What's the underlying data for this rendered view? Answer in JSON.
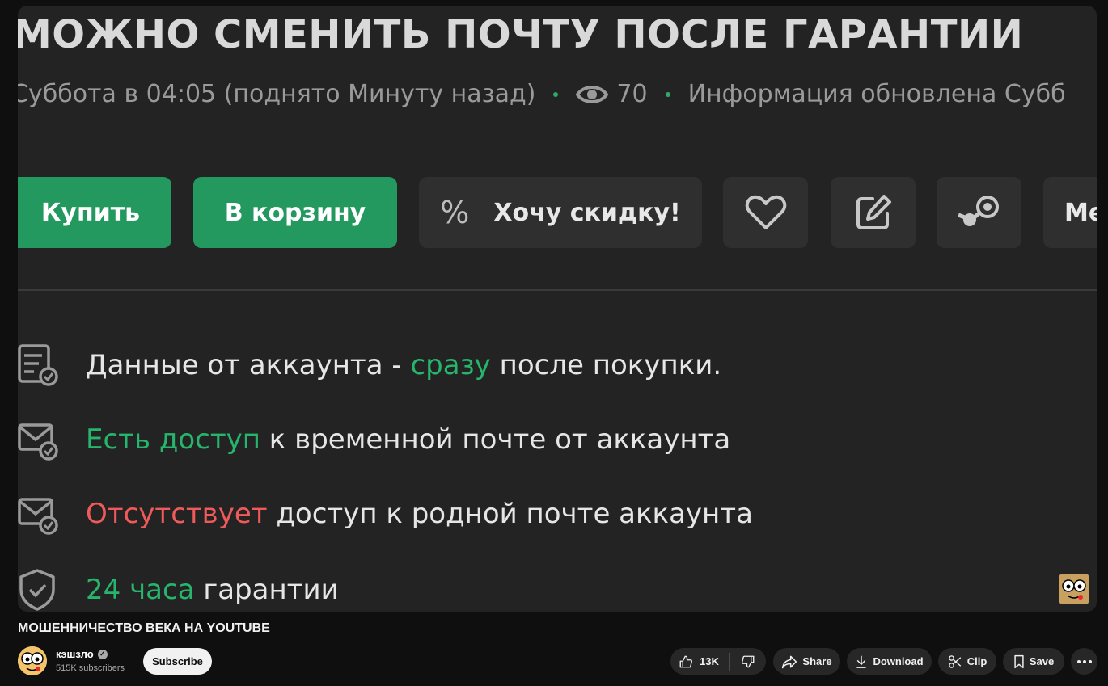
{
  "video": {
    "title": "МОЖНО СМЕНИТЬ ПОЧТУ ПОСЛЕ ГАРАНТИИ",
    "meta_posted": "Суббота в 04:05 (поднято Минуту назад)",
    "meta_views": "70",
    "meta_updated": "Информация обновлена Субб",
    "buttons": {
      "buy": "Купить",
      "cart": "В корзину",
      "discount": "Хочу скидку!",
      "more": "Ме"
    },
    "features": [
      {
        "pre": "Данные от аккаунта - ",
        "hl": "сразу",
        "post": " после покупки."
      },
      {
        "pre": "",
        "hl": "Есть доступ",
        "post": " к временной почте от аккаунта"
      },
      {
        "pre": "",
        "hl": "Отсутствует",
        "post": " доступ к родной почте аккаунта"
      },
      {
        "pre": "",
        "hl": "24 часа",
        "post": " гарантии"
      }
    ]
  },
  "page": {
    "video_title": "МОШЕННИЧЕСТВО ВЕКА НА YOUTUBE",
    "channel_name": "кэшзло",
    "subscribers": "515K subscribers",
    "subscribe_label": "Subscribe",
    "likes": "13K",
    "share_label": "Share",
    "download_label": "Download",
    "clip_label": "Clip",
    "save_label": "Save"
  },
  "colors": {
    "green_accent": "#27b46c",
    "red_accent": "#ef5a5a",
    "button_green": "#23995f"
  },
  "icons": [
    "eye-icon",
    "percent-icon",
    "heart-icon",
    "edit-icon",
    "steam-icon",
    "list-check-icon",
    "mail-check-icon",
    "shield-check-icon",
    "verified-icon",
    "like-icon",
    "dislike-icon",
    "share-icon",
    "download-icon",
    "clip-icon",
    "save-icon",
    "more-icon"
  ]
}
